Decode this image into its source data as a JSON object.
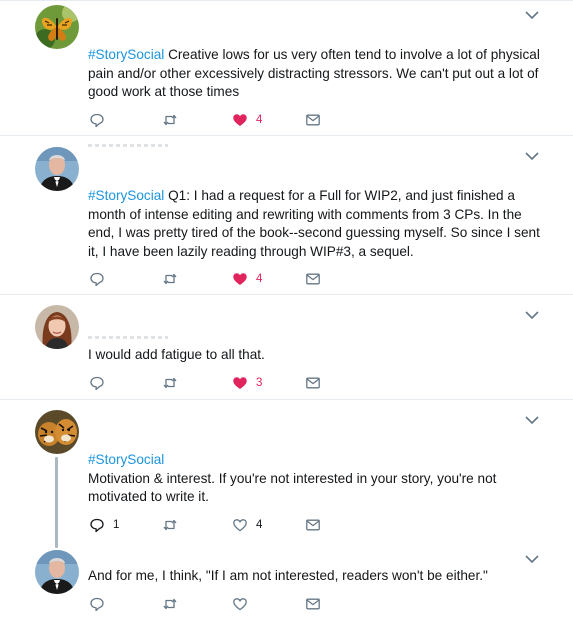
{
  "colors": {
    "hashtag": "#1b95e0",
    "like_active": "#e0245e",
    "icon": "#657786",
    "divider": "#e6ecf0"
  },
  "tweets": [
    {
      "avatar_icon": "butterfly-avatar-icon",
      "hashtag": "#StorySocial",
      "text": " Creative lows for us very often tend to involve a lot of physical pain and/or other excessively distracting stressors. We can't put out a lot of good work at those times",
      "reply_count": "",
      "retweet_count": "",
      "like_count": "4",
      "liked": true
    },
    {
      "avatar_icon": "man-tuxedo-avatar-icon",
      "hashtag": "#StorySocial",
      "text": " Q1: I had a request for a Full for WIP2, and just finished a month of intense editing and rewriting with comments from 3 CPs. In the end, I was pretty tired of the book--second guessing myself. So since I sent it, I have been lazily reading through WIP#3, a sequel.",
      "reply_count": "",
      "retweet_count": "",
      "like_count": "4",
      "liked": true
    },
    {
      "avatar_icon": "woman-avatar-icon",
      "hashtag": "",
      "text": "I would add fatigue to all that.",
      "reply_count": "",
      "retweet_count": "",
      "like_count": "3",
      "liked": true
    },
    {
      "avatar_icon": "tiger-avatar-icon",
      "hashtag": "#StorySocial",
      "text": "Motivation & interest. If you're not interested in your story, you're not motivated to write it.",
      "reply_count": "1",
      "retweet_count": "",
      "like_count": "4",
      "liked": false
    },
    {
      "avatar_icon": "man-tuxedo-avatar-icon",
      "hashtag": "",
      "text": "And for me, I think, \"If I am not interested, readers won't be either.\"",
      "reply_count": "",
      "retweet_count": "",
      "like_count": "",
      "liked": false
    }
  ]
}
